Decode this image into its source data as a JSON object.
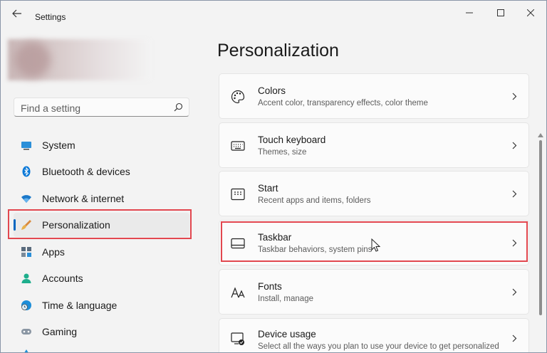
{
  "window": {
    "title": "Settings"
  },
  "sidebar": {
    "search_placeholder": "Find a setting",
    "items": [
      {
        "label": "System",
        "icon": "system-icon"
      },
      {
        "label": "Bluetooth & devices",
        "icon": "bluetooth-icon"
      },
      {
        "label": "Network & internet",
        "icon": "wifi-icon"
      },
      {
        "label": "Personalization",
        "icon": "brush-icon",
        "selected": true
      },
      {
        "label": "Apps",
        "icon": "apps-icon"
      },
      {
        "label": "Accounts",
        "icon": "accounts-icon"
      },
      {
        "label": "Time & language",
        "icon": "globe-clock-icon"
      },
      {
        "label": "Gaming",
        "icon": "gamepad-icon"
      }
    ]
  },
  "main": {
    "title": "Personalization",
    "cards": [
      {
        "title": "Colors",
        "subtitle": "Accent color, transparency effects, color theme",
        "icon": "palette-icon"
      },
      {
        "title": "Touch keyboard",
        "subtitle": "Themes, size",
        "icon": "keyboard-icon"
      },
      {
        "title": "Start",
        "subtitle": "Recent apps and items, folders",
        "icon": "start-icon"
      },
      {
        "title": "Taskbar",
        "subtitle": "Taskbar behaviors, system pins",
        "icon": "taskbar-icon",
        "highlighted": true
      },
      {
        "title": "Fonts",
        "subtitle": "Install, manage",
        "icon": "fonts-icon"
      },
      {
        "title": "Device usage",
        "subtitle": "Select all the ways you plan to use your device to get personalized",
        "icon": "device-usage-icon"
      }
    ]
  },
  "colors": {
    "accent": "#0067c0",
    "highlight_box": "#e2474f"
  }
}
